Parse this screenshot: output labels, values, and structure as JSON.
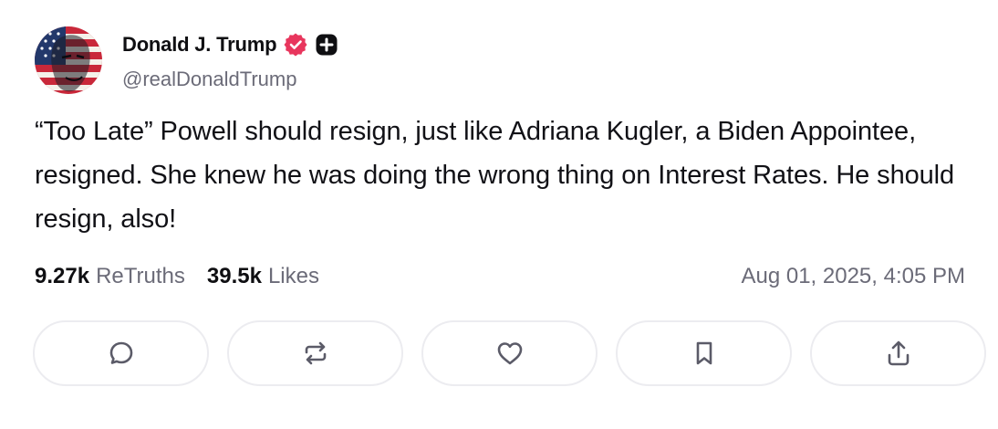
{
  "author": {
    "display_name": "Donald J. Trump",
    "handle": "@realDonaldTrump",
    "avatar_icon": "avatar-flag-portrait",
    "verified_icon": "verified-badge-icon",
    "premium_icon": "plus-badge-icon",
    "verified_color": "#e8365d"
  },
  "post": {
    "text": "“Too Late” Powell should resign, just like Adriana Kugler, a Biden Appointee, resigned. She knew he was doing the wrong thing on Interest Rates. He should resign, also!",
    "timestamp": "Aug 01, 2025, 4:05 PM"
  },
  "stats": {
    "retruths_count": "9.27k",
    "retruths_label": "ReTruths",
    "likes_count": "39.5k",
    "likes_label": "Likes"
  },
  "actions": [
    {
      "name": "reply",
      "icon": "comment-icon"
    },
    {
      "name": "retruth",
      "icon": "repost-icon"
    },
    {
      "name": "like",
      "icon": "heart-icon"
    },
    {
      "name": "bookmark",
      "icon": "bookmark-icon"
    },
    {
      "name": "share",
      "icon": "share-icon"
    }
  ],
  "colors": {
    "text_primary": "#0f0f12",
    "text_secondary": "#6b6b78",
    "button_border": "#ececf0",
    "icon": "#5b5b68"
  }
}
